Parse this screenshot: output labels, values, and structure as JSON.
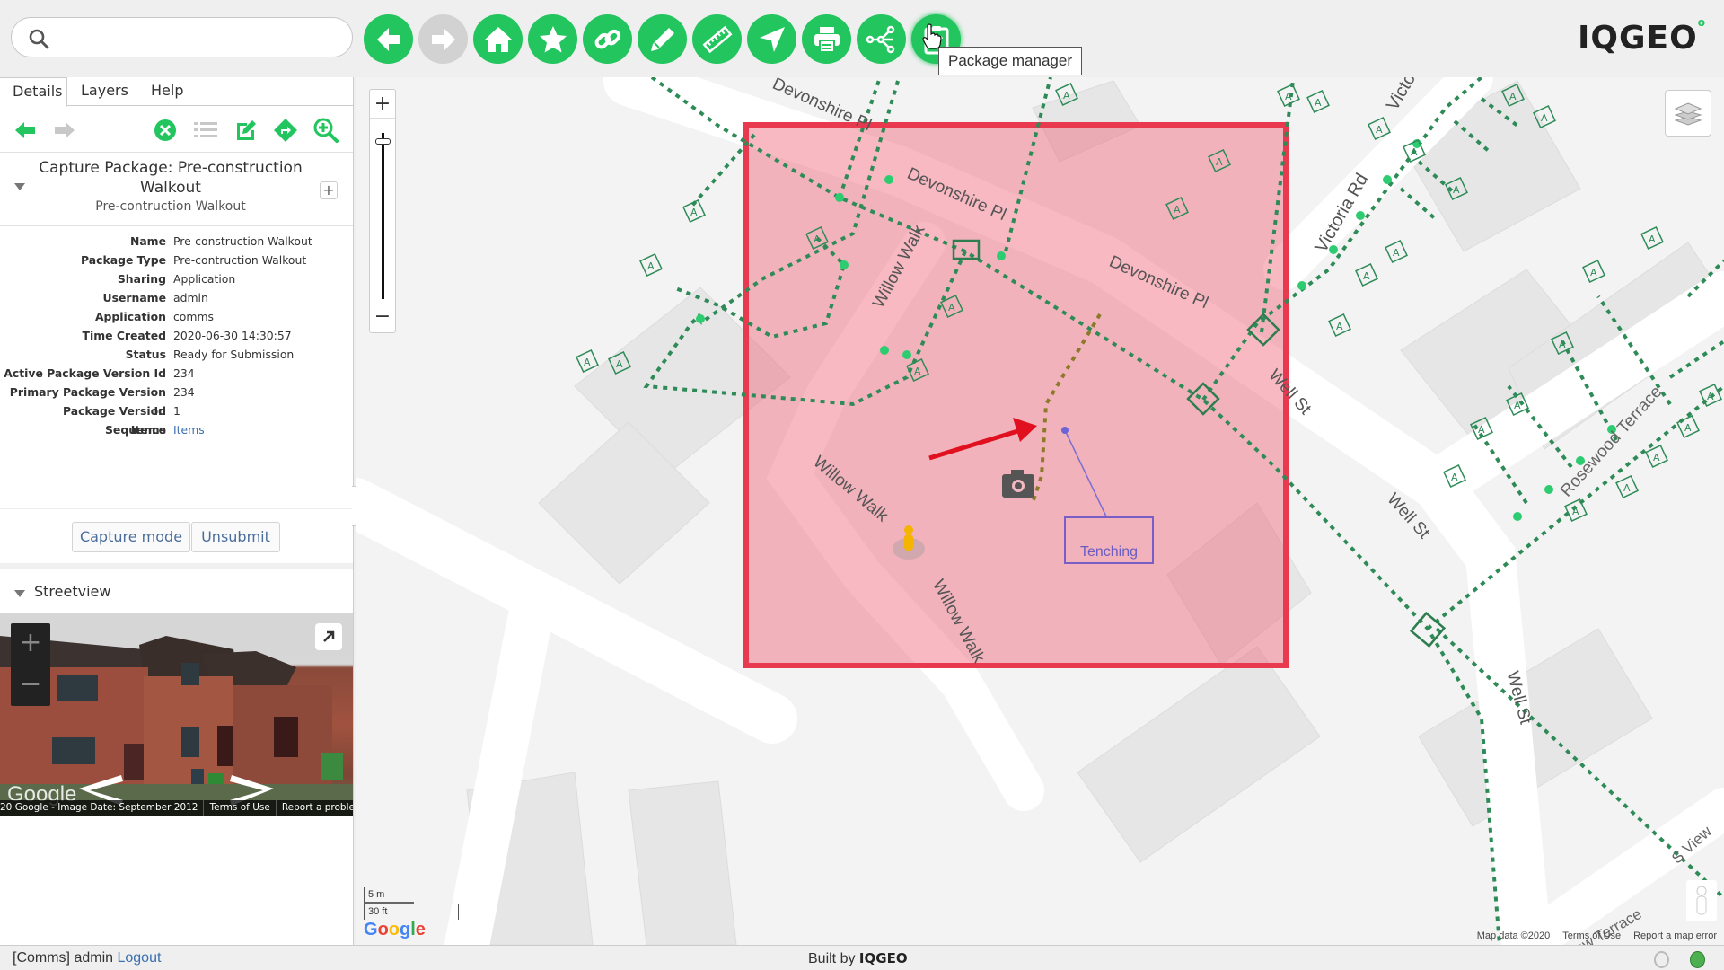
{
  "search": {
    "placeholder": "",
    "value": ""
  },
  "toolbar": {
    "buttons": [
      {
        "name": "back",
        "icon": "arrow-left-icon",
        "enabled": true
      },
      {
        "name": "forward",
        "icon": "arrow-right-icon",
        "enabled": false
      },
      {
        "name": "home",
        "icon": "home-icon",
        "enabled": true
      },
      {
        "name": "bookmarks",
        "icon": "star-icon",
        "enabled": true
      },
      {
        "name": "link",
        "icon": "link-icon",
        "enabled": true
      },
      {
        "name": "markup",
        "icon": "pencil-icon",
        "enabled": true
      },
      {
        "name": "measure",
        "icon": "ruler-icon",
        "enabled": true
      },
      {
        "name": "locate",
        "icon": "location-arrow-icon",
        "enabled": true
      },
      {
        "name": "print",
        "icon": "printer-icon",
        "enabled": true
      },
      {
        "name": "share",
        "icon": "share-network-icon",
        "enabled": true
      },
      {
        "name": "package-manager",
        "icon": "clipboard-check-icon",
        "enabled": true
      }
    ],
    "tooltip": "Package manager"
  },
  "brand": {
    "logo": "IQGEO",
    "accent": "#22c55e"
  },
  "panel": {
    "tabs": [
      {
        "label": "Details",
        "selected": true
      },
      {
        "label": "Layers",
        "selected": false
      },
      {
        "label": "Help",
        "selected": false
      }
    ],
    "title": "Capture Package: Pre-construction Walkout",
    "subtitle": "Pre-contruction Walkout",
    "plus_label": "+",
    "fields": [
      {
        "key": "Name",
        "value": "Pre-construction Walkout"
      },
      {
        "key": "Package Type",
        "value": "Pre-contruction Walkout"
      },
      {
        "key": "Sharing",
        "value": "Application"
      },
      {
        "key": "Username",
        "value": "admin"
      },
      {
        "key": "Application",
        "value": "comms"
      },
      {
        "key": "Time Created",
        "value": "2020-06-30 14:30:57"
      },
      {
        "key": "Status",
        "value": "Ready for Submission"
      },
      {
        "key": "Active Package Version Id",
        "value": "234"
      },
      {
        "key": "Primary Package Version Id",
        "value": "234"
      },
      {
        "key": "Package Version Sequence",
        "value": "1"
      },
      {
        "key": "Items",
        "value": "Items",
        "link": true
      }
    ],
    "buttons": {
      "capture_mode": "Capture mode",
      "unsubmit": "Unsubmit"
    },
    "streetview": {
      "heading": "Streetview",
      "footer": [
        "20 Google - Image Date: September 2012",
        "Terms of Use",
        "Report a problem"
      ],
      "google_label": "Google"
    },
    "collapse_label": "‹"
  },
  "map": {
    "zoom_in": "+",
    "zoom_out": "−",
    "zoom_level_fraction": 0.95,
    "street_labels": [
      "Devonshire Pl",
      "Devonshire Pl",
      "Devonshire Pl",
      "Willow Walk",
      "Willow Walk",
      "Willow Walk",
      "Victoria Rd",
      "Victo",
      "Well St",
      "Well St",
      "Well St",
      "Rosewood Terrace",
      "S View",
      "View Terrace"
    ],
    "annotation": "Tenching",
    "scale": {
      "metric": "5 m",
      "imperial": "30 ft"
    },
    "google": "Google",
    "footer": [
      "Map data ©2020",
      "Terms of Use",
      "Report a map error"
    ],
    "capture_area_color": "#e8394e"
  },
  "status": {
    "user": "[Comms] admin",
    "logout": "Logout",
    "built_by": "Built by",
    "built_by_brand": "IQGEO",
    "indicator_color": "#4caf50"
  }
}
